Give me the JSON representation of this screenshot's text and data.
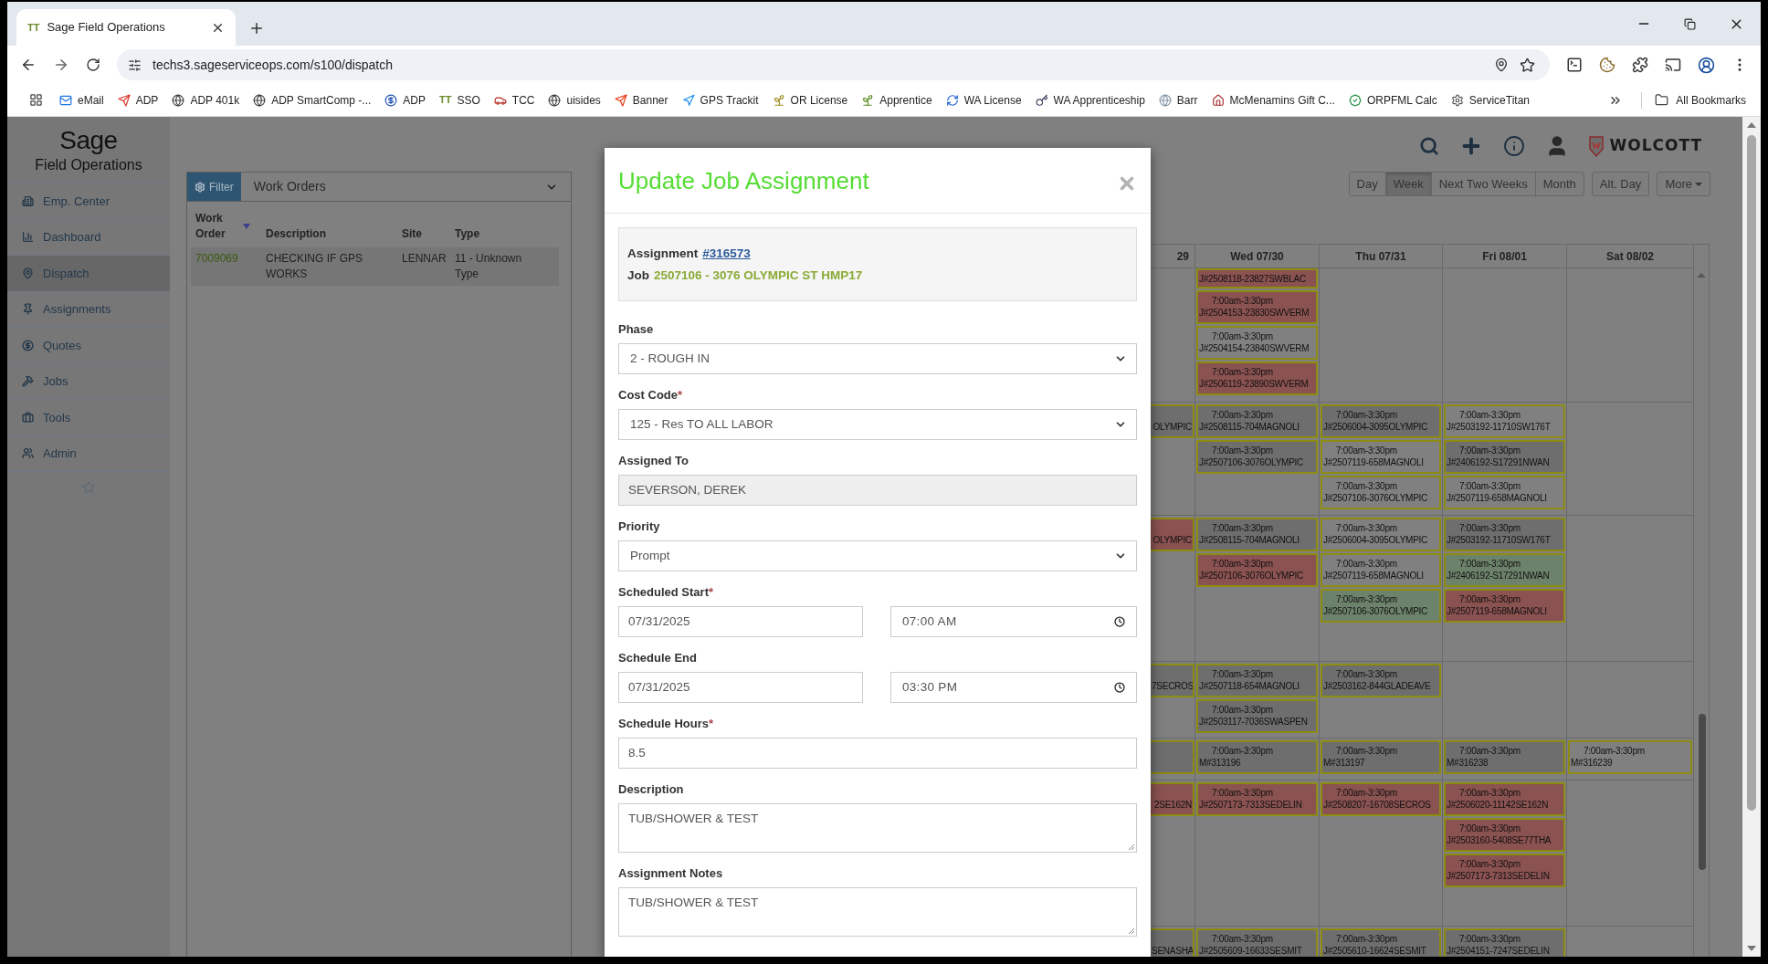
{
  "browser": {
    "tab": {
      "favicon_text": "TT",
      "title": "Sage Field Operations"
    },
    "url": "techs3.sageserviceops.com/s100/dispatch",
    "bookmarks": [
      {
        "label": "eMail"
      },
      {
        "label": "ADP"
      },
      {
        "label": "ADP 401k"
      },
      {
        "label": "ADP SmartComp -..."
      },
      {
        "label": "ADP"
      },
      {
        "label": "SSO",
        "icon_text": "TT"
      },
      {
        "label": "TCC"
      },
      {
        "label": "uisides"
      },
      {
        "label": "Banner"
      },
      {
        "label": "GPS Trackit"
      },
      {
        "label": "OR License"
      },
      {
        "label": "Apprentice"
      },
      {
        "label": "WA License"
      },
      {
        "label": "WA Apprenticeship"
      },
      {
        "label": "Barr"
      },
      {
        "label": "McMenamins Gift C..."
      },
      {
        "label": "ORPFML Calc"
      },
      {
        "label": "ServiceTitan"
      }
    ],
    "all_bookmarks": "All Bookmarks"
  },
  "sidebar": {
    "logo": "Sage",
    "subtitle": "Field Operations",
    "items": [
      {
        "label": "Emp. Center",
        "selected": false
      },
      {
        "label": "Dashboard",
        "selected": false
      },
      {
        "label": "Dispatch",
        "selected": true
      },
      {
        "label": "Assignments",
        "selected": false
      },
      {
        "label": "Quotes",
        "selected": false
      },
      {
        "label": "Jobs",
        "selected": false
      },
      {
        "label": "Tools",
        "selected": false
      },
      {
        "label": "Admin",
        "selected": false
      }
    ]
  },
  "work_orders": {
    "filter": "Filter",
    "view": "Work Orders",
    "columns": [
      "Work Order",
      "Description",
      "Site",
      "Type"
    ],
    "rows": [
      {
        "work_order": "7009069",
        "description": "CHECKING IF GPS WORKS",
        "site": "LENNAR",
        "type": "11 - Unknown Type"
      }
    ]
  },
  "calendar": {
    "logo": "WOLCOTT",
    "views": [
      {
        "label": "Day",
        "selected": false
      },
      {
        "label": "Week",
        "selected": true
      },
      {
        "label": "Next Two Weeks",
        "selected": false
      },
      {
        "label": "Month",
        "selected": false
      }
    ],
    "alt_day": "Alt. Day",
    "more": "More",
    "columns": [
      "29",
      "Wed 07/30",
      "Thu 07/31",
      "Fri 08/01",
      "Sat 08/02"
    ],
    "rows": [
      {
        "cells": [
          [],
          [
            {
              "ref": "J#2508118-23827SWBLAC",
              "color": "#8a5250"
            },
            {
              "time": "7:00am-3:30pm",
              "ref": "J#2504153-23830SWVERM",
              "color": "#8a5250"
            },
            {
              "time": "7:00am-3:30pm",
              "ref": "J#2504154-23840SWVERM",
              "color": "#808080"
            },
            {
              "time": "7:00am-3:30pm",
              "ref": "J#2506119-23890SWVERM",
              "color": "#8a5250"
            }
          ],
          [],
          [],
          []
        ]
      },
      {
        "cells": [
          [
            {
              "ref": "OLYMPIC",
              "color": "#6e6e6e"
            }
          ],
          [
            {
              "time": "7:00am-3:30pm",
              "ref": "J#2508115-704MAGNOLI",
              "color": "#6e6e6e"
            },
            {
              "time": "7:00am-3:30pm",
              "ref": "J#2507106-3076OLYMPIC",
              "color": "#6e6e6e"
            }
          ],
          [
            {
              "time": "7:00am-3:30pm",
              "ref": "J#2506004-3095OLYMPIC",
              "color": "#6e6e6e"
            },
            {
              "time": "7:00am-3:30pm",
              "ref": "J#2507119-658MAGNOLI",
              "color": "#808080"
            },
            {
              "time": "7:00am-3:30pm",
              "ref": "J#2507106-3076OLYMPIC",
              "color": "#808080"
            }
          ],
          [
            {
              "time": "7:00am-3:30pm",
              "ref": "J#2503192-11710SW176T",
              "color": "#808080"
            },
            {
              "time": "7:00am-3:30pm",
              "ref": "J#2406192-S17291NWAN",
              "color": "#6e6e6e"
            },
            {
              "time": "7:00am-3:30pm",
              "ref": "J#2507119-658MAGNOLI",
              "color": "#808080"
            }
          ],
          []
        ]
      },
      {
        "cells": [
          [
            {
              "ref": "OLYMPIC",
              "color": "#8a5250"
            }
          ],
          [
            {
              "time": "7:00am-3:30pm",
              "ref": "J#2508115-704MAGNOLI",
              "color": "#6e6e6e"
            },
            {
              "time": "7:00am-3:30pm",
              "ref": "J#2507106-3076OLYMPIC",
              "color": "#8a5250"
            }
          ],
          [
            {
              "time": "7:00am-3:30pm",
              "ref": "J#2506004-3095OLYMPIC",
              "color": "#808080"
            },
            {
              "time": "7:00am-3:30pm",
              "ref": "J#2507119-658MAGNOLI",
              "color": "#808080"
            },
            {
              "time": "7:00am-3:30pm",
              "ref": "J#2507106-3076OLYMPIC",
              "color": "#6c826a"
            }
          ],
          [
            {
              "time": "7:00am-3:30pm",
              "ref": "J#2503192-11710SW176T",
              "color": "#6e6e6e"
            },
            {
              "time": "7:00am-3:30pm",
              "ref": "J#2406192-S17291NWAN",
              "color": "#6c826a"
            },
            {
              "time": "7:00am-3:30pm",
              "ref": "J#2507119-658MAGNOLI",
              "color": "#8a5250"
            }
          ],
          []
        ]
      },
      {
        "cells": [
          [
            {
              "ref": "7SECROS",
              "color": "#6e6e6e"
            }
          ],
          [
            {
              "time": "7:00am-3:30pm",
              "ref": "J#2507118-654MAGNOLI",
              "color": "#6e6e6e"
            },
            {
              "time": "7:00am-3:30pm",
              "ref": "J#2503117-7036SWASPEN",
              "color": "#6e6e6e"
            }
          ],
          [
            {
              "time": "7:00am-3:30pm",
              "ref": "J#2503162-844GLADEAVE",
              "color": "#6e6e6e"
            }
          ],
          [],
          []
        ]
      },
      {
        "cells": [
          [
            {
              "color": "#6e6e6e"
            }
          ],
          [
            {
              "time": "7:00am-3:30pm",
              "ref": "M#313196",
              "color": "#6e6e6e"
            }
          ],
          [
            {
              "time": "7:00am-3:30pm",
              "ref": "M#313197",
              "color": "#6e6e6e"
            }
          ],
          [
            {
              "time": "7:00am-3:30pm",
              "ref": "M#316238",
              "color": "#6e6e6e"
            }
          ],
          [
            {
              "time": "7:00am-3:30pm",
              "ref": "M#316239",
              "color": "#808080"
            }
          ]
        ]
      },
      {
        "cells": [
          [
            {
              "ref": "2SE162N",
              "color": "#8a5250"
            }
          ],
          [
            {
              "time": "7:00am-3:30pm",
              "ref": "J#2507173-7313SEDELIN",
              "color": "#8a5250"
            }
          ],
          [
            {
              "time": "7:00am-3:30pm",
              "ref": "J#2508207-16708SECROS",
              "color": "#8a5250"
            }
          ],
          [
            {
              "time": "7:00am-3:30pm",
              "ref": "J#2506020-11142SE162N",
              "color": "#8a5250"
            },
            {
              "time": "7:00am-3:30pm",
              "ref": "J#2503160-5408SE77THA",
              "color": "#8a5250"
            },
            {
              "time": "7:00am-3:30pm",
              "ref": "J#2507173-7313SEDELIN",
              "color": "#8a5250"
            }
          ],
          []
        ]
      },
      {
        "cells": [
          [
            {
              "ref": "SENASHA",
              "color": "#6e6e6e"
            }
          ],
          [
            {
              "time": "7:00am-3:30pm",
              "ref": "J#2505609-16633SESMIT",
              "color": "#6e6e6e"
            }
          ],
          [
            {
              "time": "7:00am-3:30pm",
              "ref": "J#2505610-16624SESMIT",
              "color": "#6e6e6e"
            }
          ],
          [
            {
              "time": "7:00am-3:30pm",
              "ref": "J#2504151-7247SEDELIN",
              "color": "#6e6e6e"
            }
          ],
          []
        ]
      }
    ]
  },
  "modal": {
    "title": "Update Job Assignment",
    "assignment_label": "Assignment",
    "assignment_number": "#316573",
    "job_label": "Job",
    "job_value": "2507106 - 3076 OLYMPIC ST HMP17",
    "fields": [
      {
        "kind": "select",
        "label": "Phase",
        "value": "2 - ROUGH IN"
      },
      {
        "kind": "select",
        "label": "Cost Code",
        "required_mark": "*",
        "value": "125 - Res TO ALL LABOR"
      },
      {
        "kind": "readonly",
        "label": "Assigned To",
        "value": "SEVERSON, DEREK"
      },
      {
        "kind": "select",
        "label": "Priority",
        "value": "Prompt"
      },
      {
        "kind": "datetime",
        "label": "Scheduled Start",
        "required_mark": "*",
        "value": "07/31/2025",
        "time": "07:00 AM"
      },
      {
        "kind": "datetime",
        "label": "Schedule End",
        "value": "07/31/2025",
        "time": "03:30 PM"
      },
      {
        "kind": "text",
        "label": "Schedule Hours",
        "required_mark": "*",
        "value": "8.5"
      },
      {
        "kind": "textarea",
        "label": "Description",
        "value": "TUB/SHOWER & TEST"
      },
      {
        "kind": "textarea",
        "label": "Assignment Notes",
        "value": "TUB/SHOWER & TEST"
      }
    ]
  }
}
